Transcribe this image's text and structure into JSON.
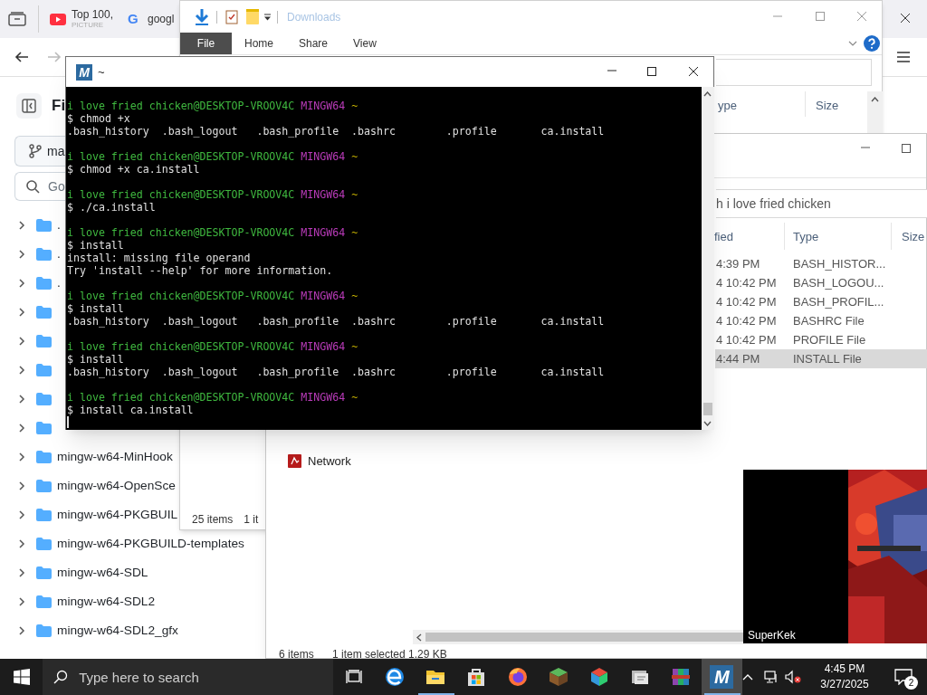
{
  "browser": {
    "tabs": [
      {
        "title": "Top 100,",
        "subtitle": "PICTURE"
      },
      {
        "title": "googl",
        "icon_letter": "G"
      }
    ],
    "nav_buttons": [
      {
        "kind": "back",
        "disabled": false
      },
      {
        "kind": "forward",
        "disabled": true
      }
    ],
    "sidebar": {
      "title": "Fi",
      "branch": "ma",
      "search": {
        "placeholder": "Go"
      },
      "tree": [
        {
          "label": ".",
          "expanded": false
        },
        {
          "label": ".",
          "expanded": false
        },
        {
          "label": ".",
          "expanded": false
        },
        {
          "expanded": false
        },
        {
          "expanded": false
        },
        {
          "expanded": false
        },
        {
          "expanded": false
        },
        {
          "expanded": false
        },
        {
          "label": "mingw-w64-MinHook",
          "expanded": false
        },
        {
          "label": "mingw-w64-OpenSce",
          "expanded": false
        },
        {
          "label": "mingw-w64-PKGBUIL",
          "expanded": false
        },
        {
          "label": "mingw-w64-PKGBUILD-templates",
          "expanded": false
        },
        {
          "label": "mingw-w64-SDL",
          "expanded": false
        },
        {
          "label": "mingw-w64-SDL2",
          "expanded": false
        },
        {
          "label": "mingw-w64-SDL2_gfx",
          "expanded": false
        }
      ]
    }
  },
  "explorer_downloads": {
    "title": "Downloads",
    "ribbon_tabs": [
      {
        "label": "File",
        "kind": "file"
      },
      {
        "label": "Home",
        "kind": "tab"
      },
      {
        "label": "Share",
        "kind": "tab"
      },
      {
        "label": "View",
        "kind": "tab"
      }
    ],
    "columns": [
      "ype",
      "Size"
    ],
    "status": [
      "25 items",
      "1 it"
    ]
  },
  "explorer_home": {
    "search": {
      "placeholder": "h i love fried chicken"
    },
    "columns": [
      "fied",
      "Type",
      "Size"
    ],
    "rows": [
      {
        "modified": "4:39 PM",
        "type": "BASH_HISTOR...",
        "selected": false
      },
      {
        "modified": "4 10:42 PM",
        "type": "BASH_LOGOU...",
        "selected": false
      },
      {
        "modified": "4 10:42 PM",
        "type": "BASH_PROFIL...",
        "selected": false
      },
      {
        "modified": "4 10:42 PM",
        "type": "BASHRC File",
        "selected": false
      },
      {
        "modified": "4 10:42 PM",
        "type": "PROFILE File",
        "selected": false
      },
      {
        "modified": "4:44 PM",
        "type": "INSTALL File",
        "selected": true
      }
    ],
    "nav": [
      {
        "label": "Network"
      }
    ],
    "status": [
      "6 items",
      "1 item selected",
      "1.29 KB"
    ]
  },
  "terminal": {
    "title": "~",
    "logo_letter": "M",
    "lines": [
      {
        "kind": "prompt",
        "user_host": "i love fried chicken@DESKTOP-VROOV4C",
        "shell": "MINGW64",
        "path": "~"
      },
      {
        "kind": "command",
        "text": "$ chmod +x"
      },
      {
        "kind": "output",
        "text": ".bash_history  .bash_logout   .bash_profile  .bashrc        .profile       ca.install"
      },
      {
        "kind": "blank"
      },
      {
        "kind": "prompt",
        "user_host": "i love fried chicken@DESKTOP-VROOV4C",
        "shell": "MINGW64",
        "path": "~"
      },
      {
        "kind": "command",
        "text": "$ chmod +x ca.install"
      },
      {
        "kind": "blank"
      },
      {
        "kind": "prompt",
        "user_host": "i love fried chicken@DESKTOP-VROOV4C",
        "shell": "MINGW64",
        "path": "~"
      },
      {
        "kind": "command",
        "text": "$ ./ca.install"
      },
      {
        "kind": "blank"
      },
      {
        "kind": "prompt",
        "user_host": "i love fried chicken@DESKTOP-VROOV4C",
        "shell": "MINGW64",
        "path": "~"
      },
      {
        "kind": "command",
        "text": "$ install"
      },
      {
        "kind": "output",
        "text": "install: missing file operand"
      },
      {
        "kind": "output",
        "text": "Try 'install --help' for more information."
      },
      {
        "kind": "blank"
      },
      {
        "kind": "prompt",
        "user_host": "i love fried chicken@DESKTOP-VROOV4C",
        "shell": "MINGW64",
        "path": "~"
      },
      {
        "kind": "command",
        "text": "$ install"
      },
      {
        "kind": "output",
        "text": ".bash_history  .bash_logout   .bash_profile  .bashrc        .profile       ca.install"
      },
      {
        "kind": "blank"
      },
      {
        "kind": "prompt",
        "user_host": "i love fried chicken@DESKTOP-VROOV4C",
        "shell": "MINGW64",
        "path": "~"
      },
      {
        "kind": "command",
        "text": "$ install"
      },
      {
        "kind": "output",
        "text": ".bash_history  .bash_logout   .bash_profile  .bashrc        .profile       ca.install"
      },
      {
        "kind": "blank"
      },
      {
        "kind": "prompt",
        "user_host": "i love fried chicken@DESKTOP-VROOV4C",
        "shell": "MINGW64",
        "path": "~"
      },
      {
        "kind": "command",
        "text": "$ install ca.install"
      },
      {
        "kind": "cursor"
      }
    ]
  },
  "video": {
    "kind": "picture",
    "caption": "SuperKek"
  },
  "taskbar": {
    "search": {
      "placeholder": "Type here to search"
    },
    "apps": [
      {
        "kind": "edge",
        "running": false,
        "selected": false
      },
      {
        "kind": "files",
        "running": true,
        "selected": false
      },
      {
        "kind": "store",
        "running": false,
        "selected": false
      },
      {
        "kind": "firefox",
        "running": false,
        "selected": false
      },
      {
        "kind": "blocks",
        "running": false,
        "selected": false
      },
      {
        "kind": "cube",
        "running": false,
        "selected": false
      },
      {
        "kind": "tools",
        "running": false,
        "selected": false
      },
      {
        "kind": "archive",
        "running": false,
        "selected": false
      },
      {
        "kind": "msys",
        "letter": "M",
        "running": true,
        "selected": true
      }
    ],
    "time": "4:45 PM",
    "date": "3/27/2025",
    "notifications": "2"
  }
}
